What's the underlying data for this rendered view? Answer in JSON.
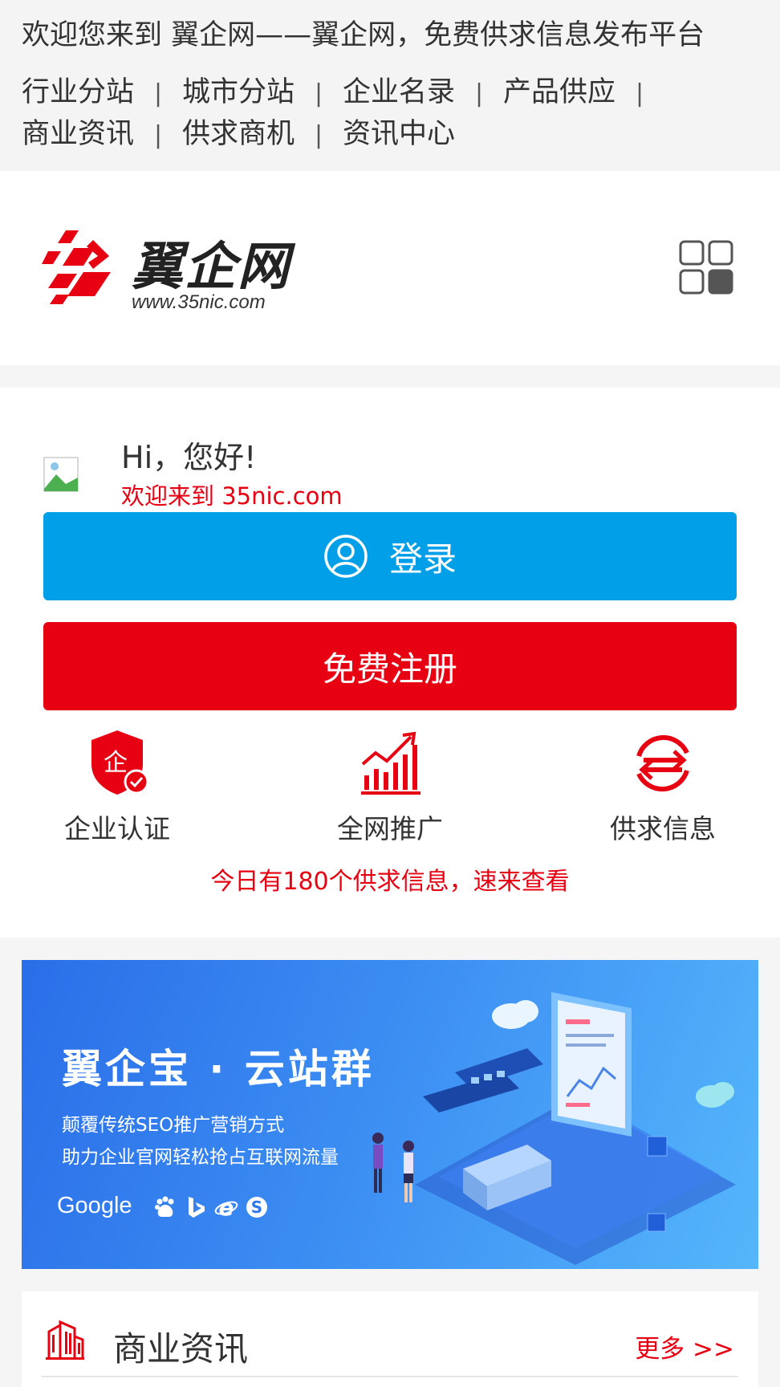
{
  "topbar": {
    "welcome": "欢迎您来到 翼企网——翼企网，免费供求信息发布平台",
    "links_row1": [
      "行业分站",
      "城市分站",
      "企业名录",
      "产品供应"
    ],
    "links_row2": [
      "商业资讯",
      "供求商机",
      "资讯中心"
    ],
    "separator": "|"
  },
  "header": {
    "logo_name": "翼企网",
    "logo_url": "www.35nic.com",
    "menu_icon": "grid-menu-icon"
  },
  "user_panel": {
    "greeting": "Hi，您好!",
    "welcome": "欢迎来到 35nic.com",
    "login_label": "登录",
    "register_label": "免费注册",
    "features": [
      {
        "label": "企业认证",
        "icon": "enterprise-certified-icon"
      },
      {
        "label": "全网推广",
        "icon": "promotion-chart-icon"
      },
      {
        "label": "供求信息",
        "icon": "supply-demand-icon"
      }
    ],
    "notice": "今日有180个供求信息，速来查看"
  },
  "banner": {
    "title": "翼企宝 · 云站群",
    "line1": "颠覆传统SEO推广营销方式",
    "line2": "助力企业官网轻松抢占互联网流量",
    "google": "Google",
    "icons": [
      "baidu-icon",
      "bing-icon",
      "ie-icon",
      "sogou-icon"
    ]
  },
  "news": {
    "title": "商业资讯",
    "more": "更多 >>"
  },
  "colors": {
    "brand_red": "#e60012",
    "login_blue": "#009fe8",
    "background": "#f5f5f5"
  }
}
